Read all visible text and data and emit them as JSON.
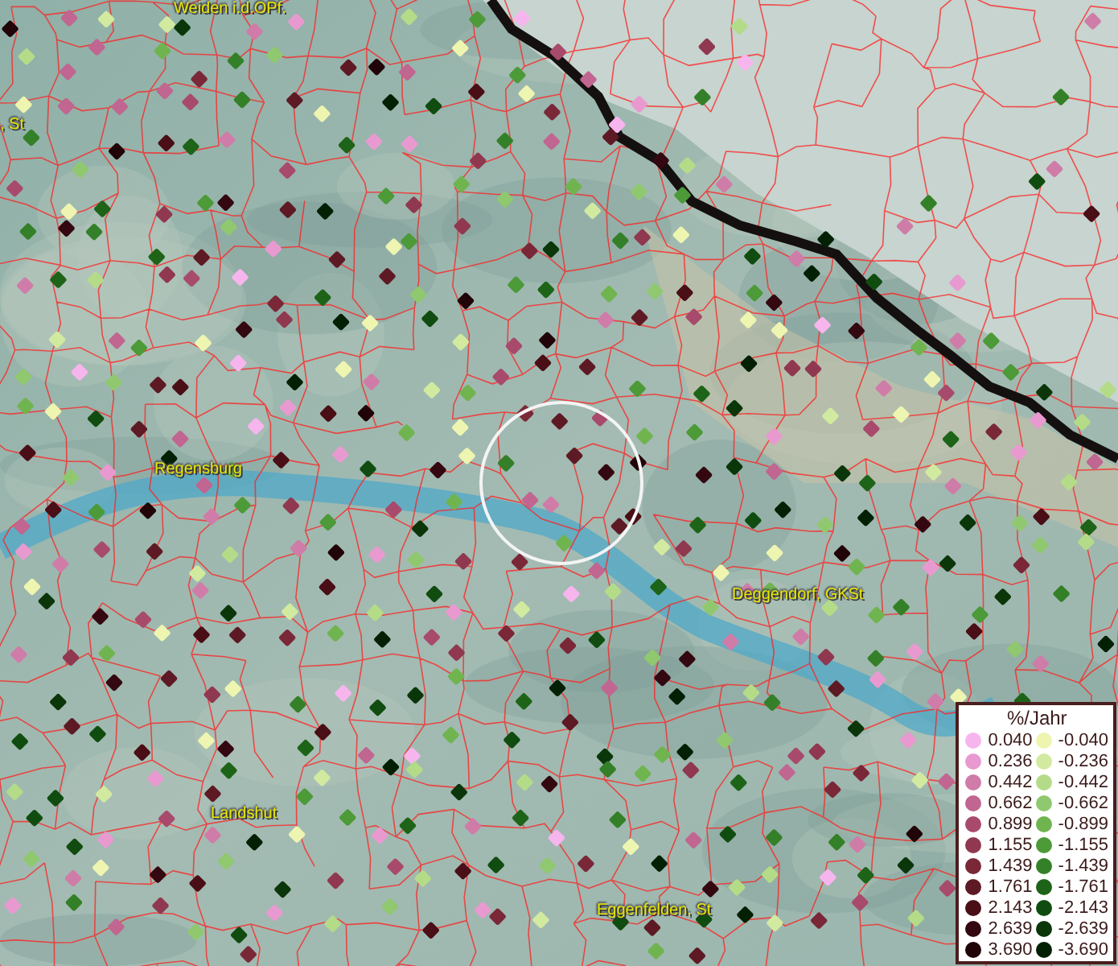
{
  "map": {
    "place_labels": [
      {
        "text": "Weiden i.d.OPf."
      },
      {
        "text": ", St"
      },
      {
        "text": "Regensburg"
      },
      {
        "text": "Deggendorf, GKSt"
      },
      {
        "text": "Landshut"
      },
      {
        "text": "Eggenfelden, St"
      }
    ]
  },
  "legend": {
    "title": "%/Jahr",
    "columns": [
      {
        "items": [
          {
            "value": "0.040",
            "color": "#f7b5ee"
          },
          {
            "value": "0.236",
            "color": "#e89ad0"
          },
          {
            "value": "0.442",
            "color": "#d07ca8"
          },
          {
            "value": "0.662",
            "color": "#c06690"
          },
          {
            "value": "0.899",
            "color": "#a84a6c"
          },
          {
            "value": "1.155",
            "color": "#903850"
          },
          {
            "value": "1.439",
            "color": "#7a2838"
          },
          {
            "value": "1.761",
            "color": "#5e1a24"
          },
          {
            "value": "2.143",
            "color": "#4a0e16"
          },
          {
            "value": "2.639",
            "color": "#340810"
          },
          {
            "value": "3.690",
            "color": "#200408"
          }
        ]
      },
      {
        "items": [
          {
            "value": "-0.040",
            "color": "#eef5b0"
          },
          {
            "value": "-0.236",
            "color": "#d2eaa0"
          },
          {
            "value": "-0.442",
            "color": "#b4dc88"
          },
          {
            "value": "-0.662",
            "color": "#90c870"
          },
          {
            "value": "-0.899",
            "color": "#70b450"
          },
          {
            "value": "-1.155",
            "color": "#4c9a38"
          },
          {
            "value": "-1.439",
            "color": "#348028"
          },
          {
            "value": "-1.761",
            "color": "#1e6418"
          },
          {
            "value": "-2.143",
            "color": "#104c10"
          },
          {
            "value": "-2.639",
            "color": "#0a360a"
          },
          {
            "value": "-3.690",
            "color": "#042004"
          }
        ]
      }
    ]
  }
}
